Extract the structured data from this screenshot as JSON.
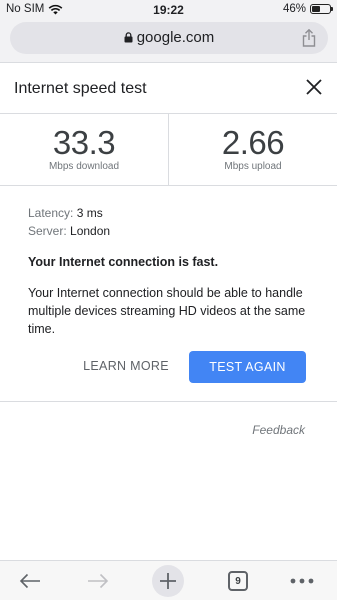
{
  "status_bar": {
    "carrier": "No SIM",
    "time": "19:22",
    "battery": "46%",
    "battery_level": 0.46
  },
  "url_bar": {
    "domain": "google.com"
  },
  "card": {
    "title": "Internet speed test",
    "download": {
      "value": "33.3",
      "unit": "Mbps download"
    },
    "upload": {
      "value": "2.66",
      "unit": "Mbps upload"
    },
    "latency_label": "Latency:",
    "latency_value": "3 ms",
    "server_label": "Server:",
    "server_value": "London",
    "headline": "Your Internet connection is fast.",
    "description": "Your Internet connection should be able to handle multiple devices streaming HD videos at the same time.",
    "learn_more": "LEARN MORE",
    "test_again": "TEST AGAIN",
    "feedback": "Feedback"
  },
  "toolbar": {
    "tab_count": "9"
  },
  "colors": {
    "accent": "#4285f4",
    "chrome_bg": "#f2f2f4"
  }
}
